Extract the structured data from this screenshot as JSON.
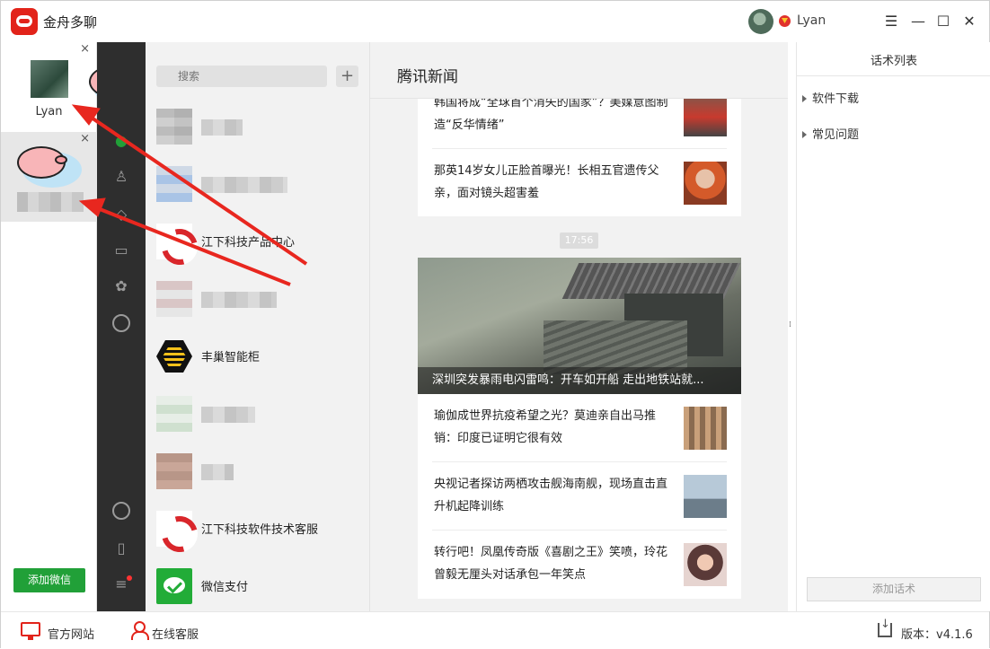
{
  "app": {
    "title": "金舟多聊"
  },
  "user": {
    "name": "Lyan"
  },
  "window_controls": {
    "menu": "☰",
    "minimize": "—",
    "maximize": "☐",
    "close": "✕"
  },
  "accounts": {
    "items": [
      {
        "name": "Lyan",
        "close": "×"
      },
      {
        "name": "",
        "close": "×"
      }
    ],
    "add_button": "添加微信"
  },
  "search": {
    "placeholder": "搜索",
    "add": "+"
  },
  "contacts": [
    {
      "name": ""
    },
    {
      "name": ""
    },
    {
      "name": "江下科技产品中心"
    },
    {
      "name": ""
    },
    {
      "name": "丰巢智能柜"
    },
    {
      "name": ""
    },
    {
      "name": ""
    },
    {
      "name": "江下科技软件技术客服"
    },
    {
      "name": "微信支付"
    }
  ],
  "news": {
    "title": "腾讯新闻",
    "time": "17:56",
    "top_items": [
      {
        "text": "韩国将成“全球首个消失的国家”？美媒意图制造“反华情绪”"
      },
      {
        "text": "那英14岁女儿正脸首曝光！长相五官遗传父亲，面对镜头超害羞"
      }
    ],
    "hero_caption": "深圳突发暴雨电闪雷鸣：开车如开船 走出地铁站就...",
    "bottom_items": [
      {
        "text": "瑜伽成世界抗疫希望之光？莫迪亲自出马推销：印度已证明它很有效"
      },
      {
        "text": "央视记者探访两栖攻击舰海南舰，现场直击直升机起降训练"
      },
      {
        "text": "转行吧！凤凰传奇版《喜剧之王》笑喷，玲花曾毅无厘头对话承包一年笑点"
      }
    ]
  },
  "scripts_panel": {
    "title": "话术列表",
    "items": [
      {
        "label": "软件下载"
      },
      {
        "label": "常见问题"
      }
    ],
    "add_button": "添加话术"
  },
  "footer": {
    "website": "官方网站",
    "support": "在线客服",
    "version": "版本：v4.1.6"
  },
  "colors": {
    "brand_red": "#e2231a",
    "wechat_green": "#21a038",
    "nav_dark": "#2e2e2e"
  }
}
